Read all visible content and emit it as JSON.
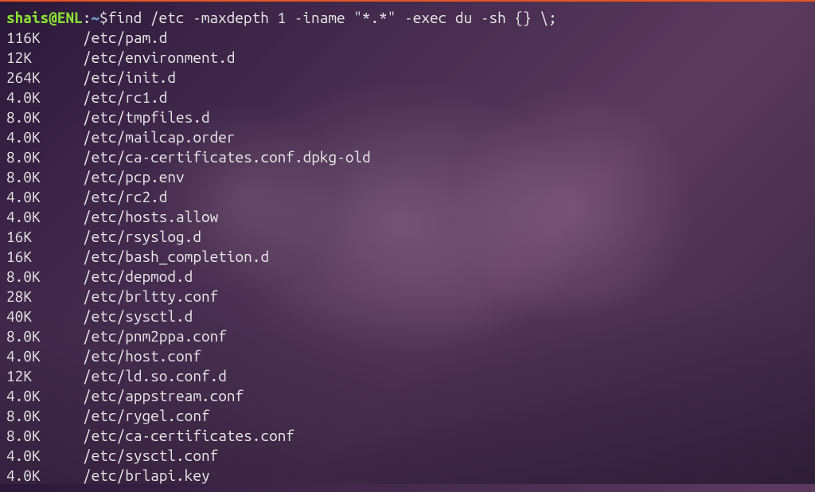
{
  "prompt": {
    "user_host": "shais@ENL",
    "colon": ":",
    "path_symbol": "~",
    "dollar": "$ ",
    "command": "find /etc -maxdepth 1 -iname \"*.*\" -exec du -sh {} \\;"
  },
  "output": [
    {
      "size": "116K",
      "path": "/etc/pam.d"
    },
    {
      "size": "12K",
      "path": "/etc/environment.d"
    },
    {
      "size": "264K",
      "path": "/etc/init.d"
    },
    {
      "size": "4.0K",
      "path": "/etc/rc1.d"
    },
    {
      "size": "8.0K",
      "path": "/etc/tmpfiles.d"
    },
    {
      "size": "4.0K",
      "path": "/etc/mailcap.order"
    },
    {
      "size": "8.0K",
      "path": "/etc/ca-certificates.conf.dpkg-old"
    },
    {
      "size": "8.0K",
      "path": "/etc/pcp.env"
    },
    {
      "size": "4.0K",
      "path": "/etc/rc2.d"
    },
    {
      "size": "4.0K",
      "path": "/etc/hosts.allow"
    },
    {
      "size": "16K",
      "path": "/etc/rsyslog.d"
    },
    {
      "size": "16K",
      "path": "/etc/bash_completion.d"
    },
    {
      "size": "8.0K",
      "path": "/etc/depmod.d"
    },
    {
      "size": "28K",
      "path": "/etc/brltty.conf"
    },
    {
      "size": "40K",
      "path": "/etc/sysctl.d"
    },
    {
      "size": "8.0K",
      "path": "/etc/pnm2ppa.conf"
    },
    {
      "size": "4.0K",
      "path": "/etc/host.conf"
    },
    {
      "size": "12K",
      "path": "/etc/ld.so.conf.d"
    },
    {
      "size": "4.0K",
      "path": "/etc/appstream.conf"
    },
    {
      "size": "8.0K",
      "path": "/etc/rygel.conf"
    },
    {
      "size": "8.0K",
      "path": "/etc/ca-certificates.conf"
    },
    {
      "size": "4.0K",
      "path": "/etc/sysctl.conf"
    },
    {
      "size": "4.0K",
      "path": "/etc/brlapi.key"
    }
  ]
}
